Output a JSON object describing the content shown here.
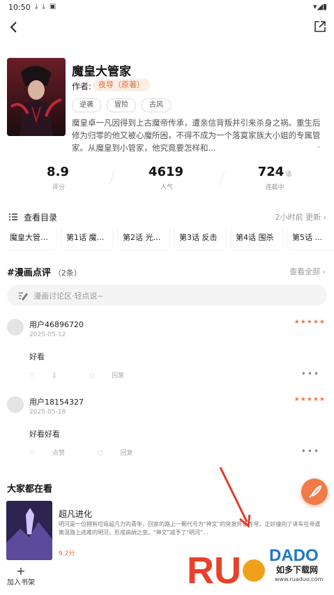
{
  "status_bar": {
    "time": "10:50"
  },
  "book": {
    "title": "魔皇大管家",
    "author_label": "作者:",
    "author": "夜导（原著）",
    "tags": [
      "逆袭",
      "冒险",
      "古风"
    ],
    "description": "魔皇卓一凡因得到上古魔帝传承，遭亲信背叛并引来杀身之祸。重生后修为归零的他又被心魔所困，不得不成为一个落寞家族大小姐的专属管家。从魔皇到小管家，他究竟要怎样和..."
  },
  "stats": [
    {
      "value": "8.9",
      "unit": "",
      "label": "评分"
    },
    {
      "value": "4619",
      "unit": "",
      "label": "人气"
    },
    {
      "value": "724",
      "unit": "话",
      "label": "连载中"
    }
  ],
  "toc": {
    "label": "查看目录",
    "updated": "2小时前 更新 ›",
    "chapters": [
      "魔皇大管家 …",
      "第1话 魔皇的…",
      "第2话 光速突…",
      "第3话 反击",
      "第4话 围杀",
      "第5话 ..."
    ]
  },
  "reviews_section": {
    "title": "#漫画点评",
    "count": "（2条）",
    "see_all": "查看全部 ›",
    "input_placeholder": "漫画讨论区·轻点说~"
  },
  "reviews": [
    {
      "user": "用户46896720",
      "date": "2025-05-12",
      "stars": "★★★★★",
      "body": "好看",
      "likes": "1",
      "reply": "回复"
    },
    {
      "user": "用户18154327",
      "date": "2025-05-18",
      "stars": "★★★★★",
      "body": "好看好看",
      "likes": "点赞",
      "reply": "回复"
    }
  ],
  "recommend": {
    "title": "大家都在看",
    "name": "超凡进化",
    "desc": "明河是一位拥有垃圾超凡力的青年，回家的路上一颗代号为\"神文\"的突发异象苍穹，正好撞向了讲车在帝道离混路上逃难的明河，形成病纳之变。\"神文\"减予了\"明河\"…",
    "score": "9.2分"
  },
  "bottom": {
    "add_shelf": "加入书架"
  },
  "watermark": {
    "brand": "RUANADO",
    "cn": "如多下载网",
    "url": "www.ruaduo.com"
  },
  "colors": {
    "accent": "#f07a48",
    "author_chip_bg": "#fdeee5"
  },
  "icons": [
    "back-arrow-icon",
    "share-icon",
    "list-icon",
    "edit-icon",
    "like-icon",
    "reply-icon",
    "more-icon",
    "plus-icon",
    "feather-icon"
  ]
}
